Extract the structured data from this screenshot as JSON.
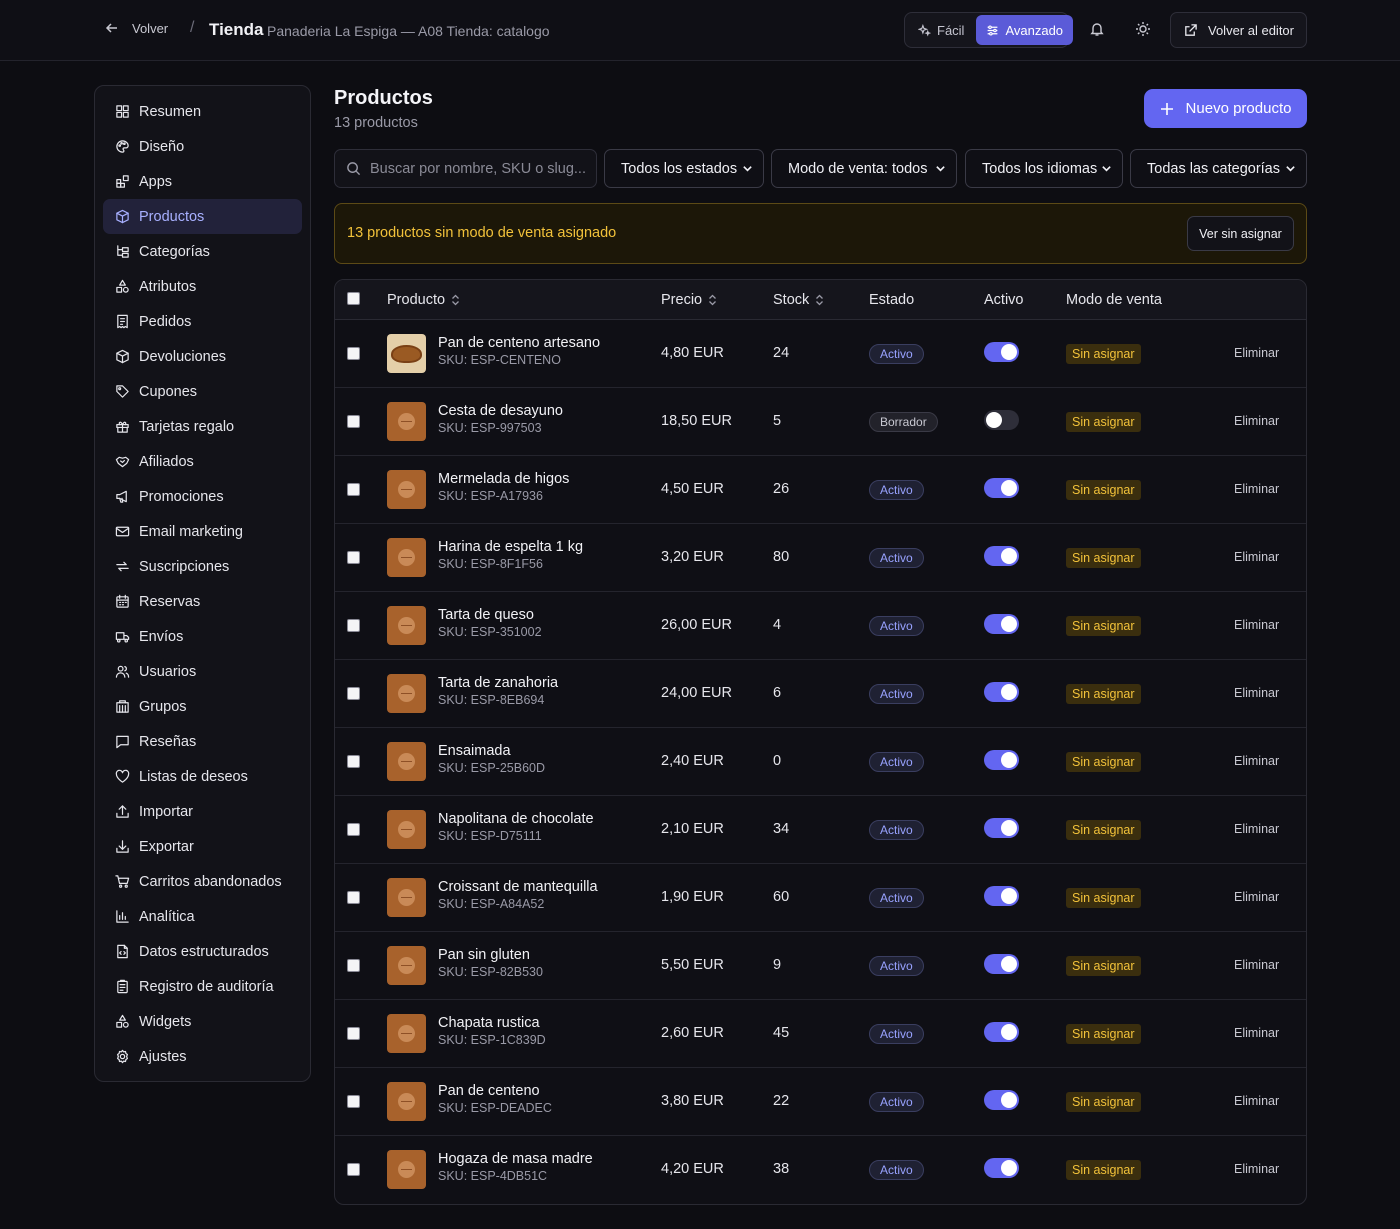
{
  "topbar": {
    "back_label": "Volver",
    "separator": "/",
    "title": "Tienda",
    "subtitle": "Panaderia La Espiga — A08 Tienda: catalogo",
    "mode_easy": "Fácil",
    "mode_advanced": "Avanzado",
    "editor_label": "Volver al editor"
  },
  "sidebar": {
    "items": [
      {
        "label": "Resumen",
        "icon": "grid-icon"
      },
      {
        "label": "Diseño",
        "icon": "palette-icon"
      },
      {
        "label": "Apps",
        "icon": "apps-icon"
      },
      {
        "label": "Productos",
        "icon": "box-icon",
        "active": true
      },
      {
        "label": "Categorías",
        "icon": "tree-icon"
      },
      {
        "label": "Atributos",
        "icon": "shapes-icon"
      },
      {
        "label": "Pedidos",
        "icon": "receipt-icon"
      },
      {
        "label": "Devoluciones",
        "icon": "box-return-icon"
      },
      {
        "label": "Cupones",
        "icon": "tag-icon"
      },
      {
        "label": "Tarjetas regalo",
        "icon": "gift-icon"
      },
      {
        "label": "Afiliados",
        "icon": "handshake-icon"
      },
      {
        "label": "Promociones",
        "icon": "megaphone-icon"
      },
      {
        "label": "Email marketing",
        "icon": "mail-icon"
      },
      {
        "label": "Suscripciones",
        "icon": "repeat-icon"
      },
      {
        "label": "Reservas",
        "icon": "calendar-icon"
      },
      {
        "label": "Envíos",
        "icon": "truck-icon"
      },
      {
        "label": "Usuarios",
        "icon": "users-icon"
      },
      {
        "label": "Grupos",
        "icon": "building-icon"
      },
      {
        "label": "Reseñas",
        "icon": "message-icon"
      },
      {
        "label": "Listas de deseos",
        "icon": "heart-icon"
      },
      {
        "label": "Importar",
        "icon": "upload-icon"
      },
      {
        "label": "Exportar",
        "icon": "download-icon"
      },
      {
        "label": "Carritos abandonados",
        "icon": "cart-icon"
      },
      {
        "label": "Analítica",
        "icon": "bar-chart-icon"
      },
      {
        "label": "Datos estructurados",
        "icon": "file-code-icon"
      },
      {
        "label": "Registro de auditoría",
        "icon": "clipboard-icon"
      },
      {
        "label": "Widgets",
        "icon": "shapes-icon"
      },
      {
        "label": "Ajustes",
        "icon": "gear-icon"
      }
    ]
  },
  "main": {
    "title": "Productos",
    "count": "13 productos",
    "new_button": "Nuevo producto",
    "search_placeholder": "Buscar por nombre, SKU o slug...",
    "filters": {
      "status": "Todos los estados",
      "sale_mode": "Modo de venta: todos",
      "language": "Todos los idiomas",
      "category": "Todas las categorías"
    },
    "warning": {
      "text": "13 productos sin modo de venta asignado",
      "button": "Ver sin asignar"
    }
  },
  "table": {
    "headers": {
      "product": "Producto",
      "price": "Precio",
      "stock": "Stock",
      "status": "Estado",
      "active": "Activo",
      "sale_mode": "Modo de venta"
    },
    "delete_label": "Eliminar",
    "rows": [
      {
        "name": "Pan de centeno artesano",
        "sku": "SKU: ESP-CENTENO",
        "price": "4,80 EUR",
        "stock": "24",
        "status": "Activo",
        "active": true,
        "sale_mode": "Sin asignar",
        "photo": true
      },
      {
        "name": "Cesta de desayuno",
        "sku": "SKU: ESP-997503",
        "price": "18,50 EUR",
        "stock": "5",
        "status": "Borrador",
        "active": false,
        "sale_mode": "Sin asignar",
        "photo": false
      },
      {
        "name": "Mermelada de higos",
        "sku": "SKU: ESP-A17936",
        "price": "4,50 EUR",
        "stock": "26",
        "status": "Activo",
        "active": true,
        "sale_mode": "Sin asignar",
        "photo": false
      },
      {
        "name": "Harina de espelta 1 kg",
        "sku": "SKU: ESP-8F1F56",
        "price": "3,20 EUR",
        "stock": "80",
        "status": "Activo",
        "active": true,
        "sale_mode": "Sin asignar",
        "photo": false
      },
      {
        "name": "Tarta de queso",
        "sku": "SKU: ESP-351002",
        "price": "26,00 EUR",
        "stock": "4",
        "status": "Activo",
        "active": true,
        "sale_mode": "Sin asignar",
        "photo": false
      },
      {
        "name": "Tarta de zanahoria",
        "sku": "SKU: ESP-8EB694",
        "price": "24,00 EUR",
        "stock": "6",
        "status": "Activo",
        "active": true,
        "sale_mode": "Sin asignar",
        "photo": false
      },
      {
        "name": "Ensaimada",
        "sku": "SKU: ESP-25B60D",
        "price": "2,40 EUR",
        "stock": "0",
        "status": "Activo",
        "active": true,
        "sale_mode": "Sin asignar",
        "photo": false
      },
      {
        "name": "Napolitana de chocolate",
        "sku": "SKU: ESP-D75111",
        "price": "2,10 EUR",
        "stock": "34",
        "status": "Activo",
        "active": true,
        "sale_mode": "Sin asignar",
        "photo": false
      },
      {
        "name": "Croissant de mantequilla",
        "sku": "SKU: ESP-A84A52",
        "price": "1,90 EUR",
        "stock": "60",
        "status": "Activo",
        "active": true,
        "sale_mode": "Sin asignar",
        "photo": false
      },
      {
        "name": "Pan sin gluten",
        "sku": "SKU: ESP-82B530",
        "price": "5,50 EUR",
        "stock": "9",
        "status": "Activo",
        "active": true,
        "sale_mode": "Sin asignar",
        "photo": false
      },
      {
        "name": "Chapata rustica",
        "sku": "SKU: ESP-1C839D",
        "price": "2,60 EUR",
        "stock": "45",
        "status": "Activo",
        "active": true,
        "sale_mode": "Sin asignar",
        "photo": false
      },
      {
        "name": "Pan de centeno",
        "sku": "SKU: ESP-DEADEC",
        "price": "3,80 EUR",
        "stock": "22",
        "status": "Activo",
        "active": true,
        "sale_mode": "Sin asignar",
        "photo": false
      },
      {
        "name": "Hogaza de masa madre",
        "sku": "SKU: ESP-4DB51C",
        "price": "4,20 EUR",
        "stock": "38",
        "status": "Activo",
        "active": true,
        "sale_mode": "Sin asignar",
        "photo": false
      }
    ]
  },
  "colors": {
    "accent": "#6366f1",
    "warning": "#f2c23a",
    "background": "#0d0d12"
  }
}
